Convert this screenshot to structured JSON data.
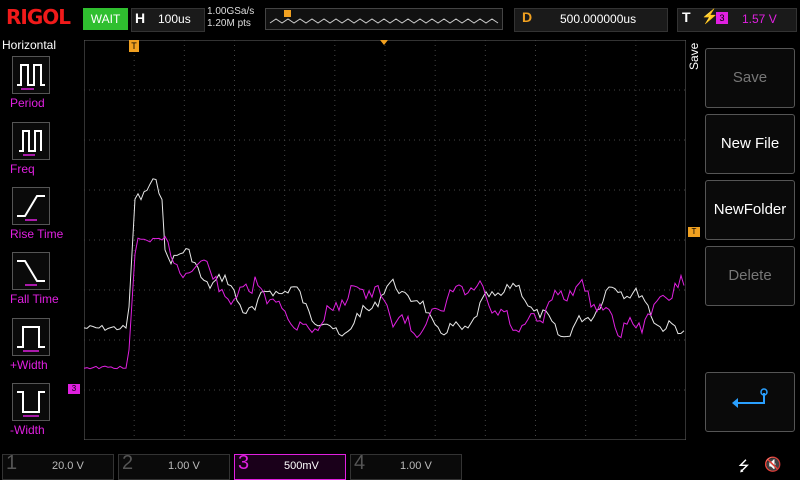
{
  "header": {
    "logo": "RIGOL",
    "run_state": "WAIT",
    "horizontal_label": "H",
    "timebase": "100us",
    "sample_rate": "1.00GSa/s",
    "memory_depth": "1.20M pts",
    "delay_label": "D",
    "delay_value": "500.000000us",
    "trigger_label": "T",
    "trigger_source": "3",
    "trigger_level": "1.57 V"
  },
  "left_panel": {
    "title": "Horizontal",
    "items": [
      {
        "label": "Period",
        "icon": "period-icon"
      },
      {
        "label": "Freq",
        "icon": "frequency-icon"
      },
      {
        "label": "Rise Time",
        "icon": "rise-time-icon"
      },
      {
        "label": "Fall Time",
        "icon": "fall-time-icon"
      },
      {
        "label": "+Width",
        "icon": "positive-width-icon"
      },
      {
        "label": "-Width",
        "icon": "negative-width-icon"
      }
    ]
  },
  "right_menu": {
    "title": "Save",
    "buttons": [
      {
        "label": "Save",
        "enabled": false
      },
      {
        "label": "New File",
        "enabled": true
      },
      {
        "label": "NewFolder",
        "enabled": true
      },
      {
        "label": "Delete",
        "enabled": false
      },
      {
        "label": "",
        "icon": "enter-return-icon",
        "enabled": true
      }
    ]
  },
  "channels": [
    {
      "num": "1",
      "scale": "20.0 V",
      "color": "#f0f000",
      "active": false
    },
    {
      "num": "2",
      "scale": "1.00 V",
      "color": "#00e0e0",
      "active": false
    },
    {
      "num": "3",
      "scale": "500mV",
      "color": "#e020e0",
      "active": true
    },
    {
      "num": "4",
      "scale": "1.00 V",
      "color": "#3050ff",
      "active": false
    }
  ],
  "markers": {
    "trigger_pos": "T",
    "channel3_ground": "3",
    "trigger_level_marker": "T"
  },
  "colors": {
    "white_trace": "#e8e8e8",
    "magenta_trace": "#e020e0",
    "grid": "#555555",
    "run_green": "#2fbf2f",
    "brand_red": "#f01a1a",
    "delay_orange": "#f0a020"
  }
}
